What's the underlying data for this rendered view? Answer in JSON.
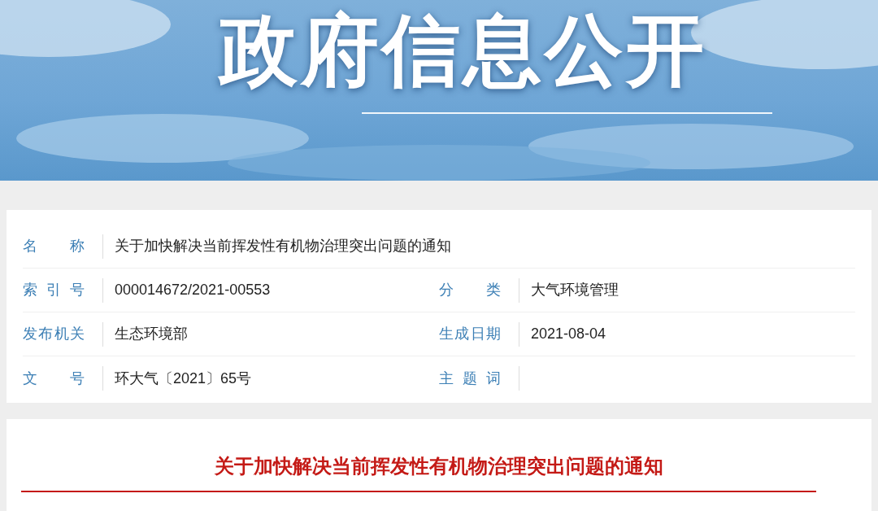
{
  "banner": {
    "title": "政府信息公开"
  },
  "metadata": [
    {
      "fields": [
        {
          "label": "名称",
          "value": "关于加快解决当前挥发性有机物治理突出问题的通知"
        }
      ]
    },
    {
      "fields": [
        {
          "label": "索引号",
          "value": "000014672/2021-00553"
        },
        {
          "label": "分类",
          "value": "大气环境管理"
        }
      ]
    },
    {
      "fields": [
        {
          "label": "发布机关",
          "value": "生态环境部"
        },
        {
          "label": "生成日期",
          "value": "2021-08-04"
        }
      ]
    },
    {
      "fields": [
        {
          "label": "文号",
          "value": "环大气〔2021〕65号"
        },
        {
          "label": "主题词"
        }
      ]
    }
  ],
  "article": {
    "title": "关于加快解决当前挥发性有机物治理突出问题的通知"
  }
}
